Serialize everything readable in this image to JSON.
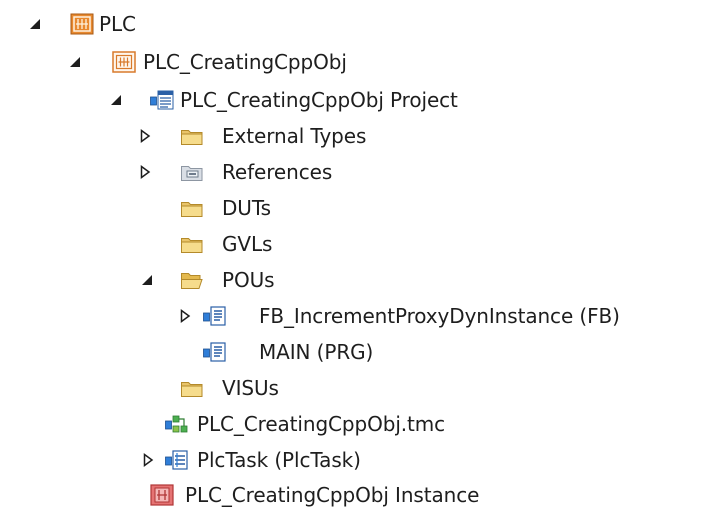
{
  "tree": {
    "plc": "PLC",
    "project_root": "PLC_CreatingCppObj",
    "project": "PLC_CreatingCppObj Project",
    "external_types": "External Types",
    "references": "References",
    "duts": "DUTs",
    "gvls": "GVLs",
    "pous": "POUs",
    "fb_increment": "FB_IncrementProxyDynInstance (FB)",
    "main": "MAIN (PRG)",
    "visus": "VISUs",
    "tmc": "PLC_CreatingCppObj.tmc",
    "plctask": "PlcTask (PlcTask)",
    "instance": "PLC_CreatingCppObj Instance"
  }
}
